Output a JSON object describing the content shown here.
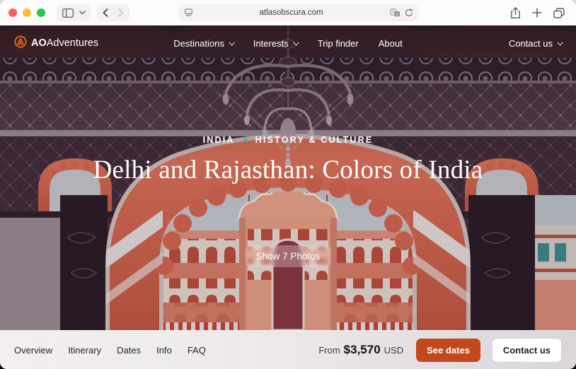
{
  "browser": {
    "url": "atlasobscura.com"
  },
  "nav": {
    "logo_bold": "AO",
    "logo_text": "Adventures",
    "items": [
      {
        "label": "Destinations",
        "dropdown": true
      },
      {
        "label": "Interests",
        "dropdown": true
      },
      {
        "label": "Trip finder",
        "dropdown": false
      },
      {
        "label": "About",
        "dropdown": false
      }
    ],
    "contact_label": "Contact us"
  },
  "hero": {
    "country": "INDIA",
    "category": "HISTORY & CULTURE",
    "title": "Delhi and Rajasthan: Colors of India",
    "photos_button": "Show 7 Photos"
  },
  "footer": {
    "tabs": [
      "Overview",
      "Itinerary",
      "Dates",
      "Info",
      "FAQ"
    ],
    "price_prefix": "From",
    "price": "$3,570",
    "currency": "USD",
    "see_dates_label": "See dates",
    "contact_label": "Contact us"
  },
  "colors": {
    "accent_orange": "#C1491C",
    "teal_dot": "#2FB9A8",
    "arch_salmon": "#DD6A52",
    "logo_orange": "#ED6A1F"
  }
}
